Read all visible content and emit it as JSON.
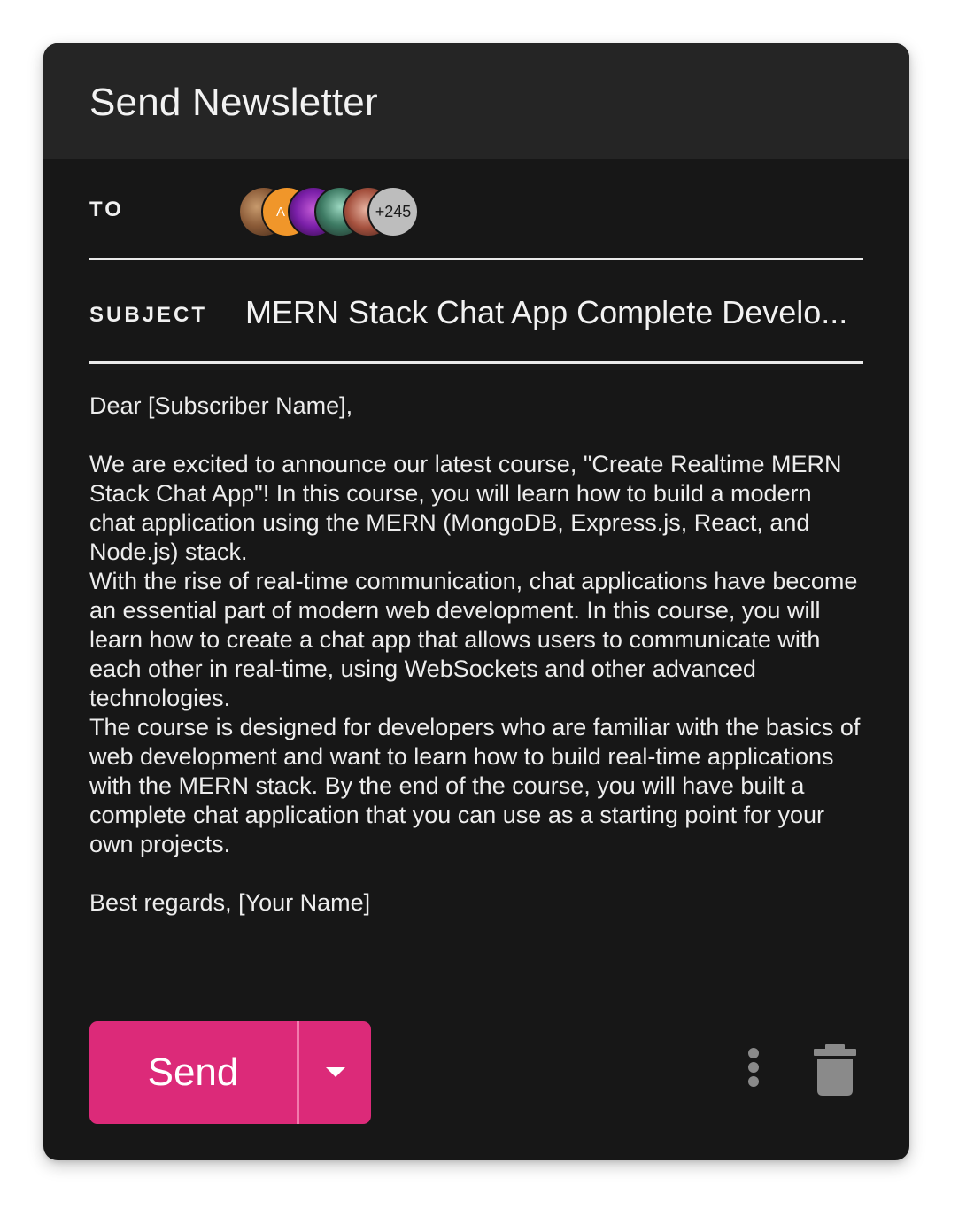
{
  "header": {
    "title": "Send Newsletter"
  },
  "to": {
    "label": "TO",
    "avatars": [
      {
        "name": "recipient-avatar-1",
        "initial": ""
      },
      {
        "name": "recipient-avatar-2",
        "initial": "A"
      },
      {
        "name": "recipient-avatar-3",
        "initial": ""
      },
      {
        "name": "recipient-avatar-4",
        "initial": ""
      },
      {
        "name": "recipient-avatar-5",
        "initial": ""
      }
    ],
    "more_count": "+245"
  },
  "subject": {
    "label": "SUBJECT",
    "value": "MERN Stack  Chat App Complete Develo..."
  },
  "body": {
    "greeting": "Dear [Subscriber Name],",
    "paragraph_1": "We are excited to announce our latest course, \"Create Realtime MERN Stack Chat App\"! In this course, you will learn how to build a modern chat application using the MERN (MongoDB, Express.js, React, and Node.js) stack.",
    "paragraph_2": "With the rise of real-time communication, chat applications have become an essential part of modern web development. In this course, you will learn how to create a chat app that allows users to communicate with each other in real-time, using WebSockets and other advanced technologies.",
    "paragraph_3": "The course is designed for developers who are familiar with the basics of web development and want to learn how to build real-time applications with the MERN stack. By the end of the course, you will have built a complete chat application that you can use as a starting point for your own projects.",
    "signoff": "Best regards, [Your Name]"
  },
  "actions": {
    "send_label": "Send",
    "dropdown_icon": "caret-down-icon",
    "more_icon": "more-vertical-icon",
    "delete_icon": "trash-icon"
  },
  "colors": {
    "accent": "#dc2a79",
    "card_background": "#171717",
    "header_background": "#252525",
    "icon_gray": "#8a8a8a"
  }
}
